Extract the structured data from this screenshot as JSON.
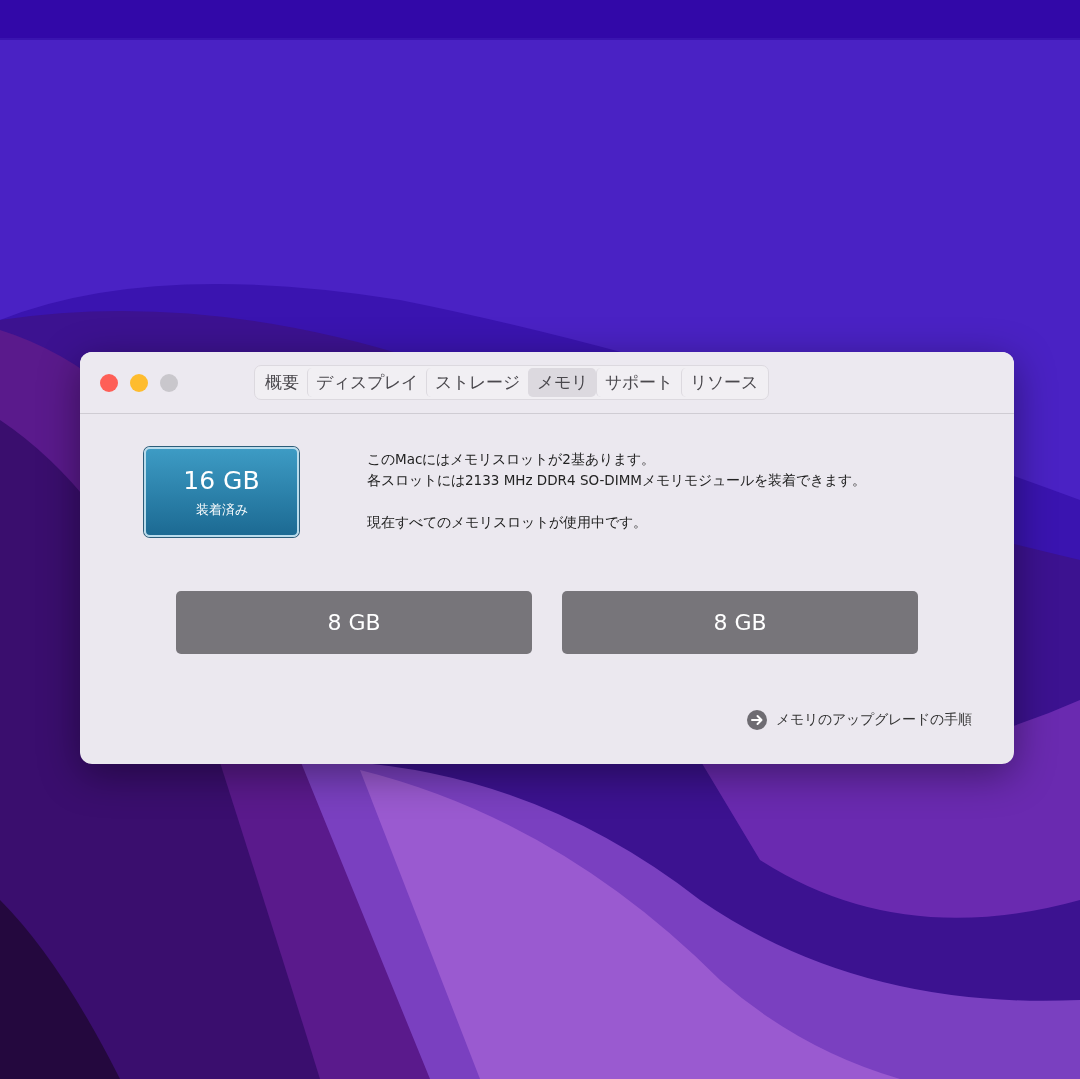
{
  "window": {
    "controls": [
      {
        "color": "#fe5f57"
      },
      {
        "color": "#febc2e"
      },
      {
        "color": "#c9c7cc"
      }
    ],
    "tabs": [
      {
        "label": "概要",
        "selected": false
      },
      {
        "label": "ディスプレイ",
        "selected": false
      },
      {
        "label": "ストレージ",
        "selected": false
      },
      {
        "label": "メモリ",
        "selected": true
      },
      {
        "label": "サポート",
        "selected": false
      },
      {
        "label": "リソース",
        "selected": false
      }
    ]
  },
  "memory": {
    "total": "16 GB",
    "status": "装着済み",
    "info": [
      "このMacにはメモリスロットが2基あります。",
      "各スロットには2133 MHz DDR4 SO-DIMMメモリモジュールを装着できます。",
      "現在すべてのメモリスロットが使用中です。"
    ],
    "slots": [
      "8 GB",
      "8 GB"
    ],
    "link": "メモリのアップグレードの手順"
  }
}
